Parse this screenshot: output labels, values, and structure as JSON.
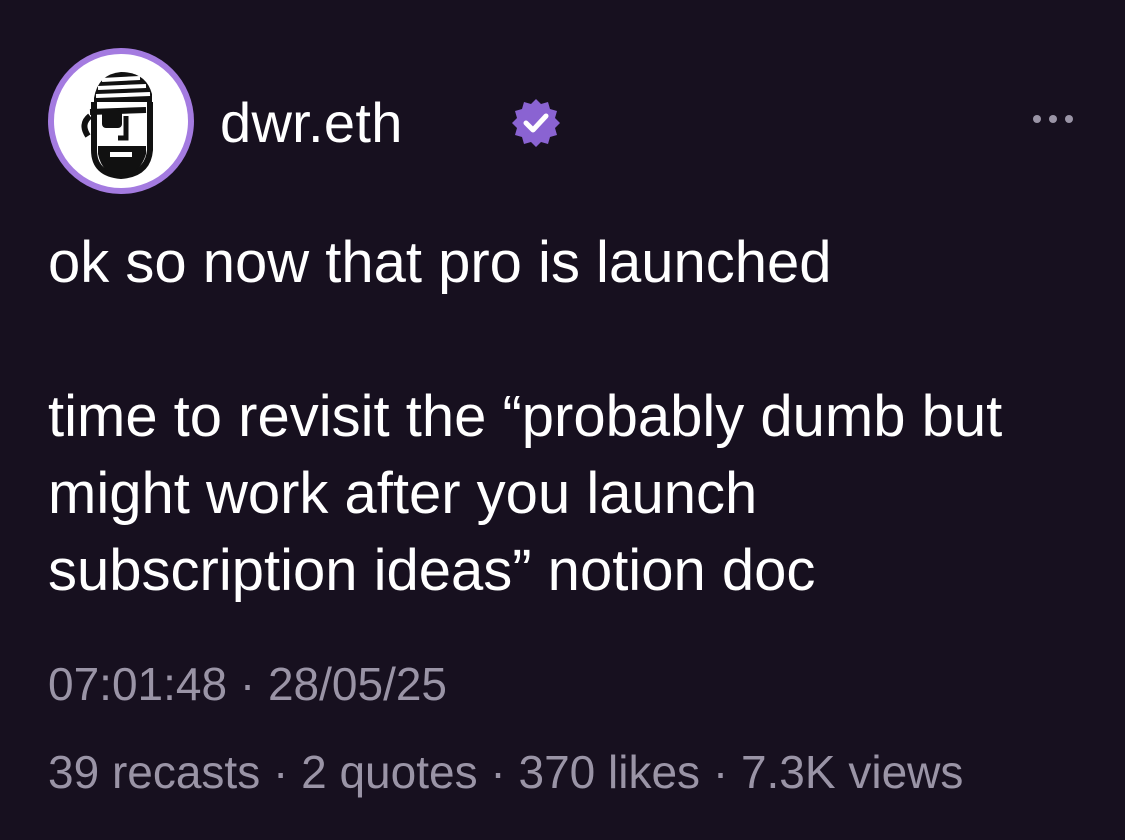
{
  "author": {
    "username": "dwr.eth",
    "verified": true,
    "avatar_icon": "pirate-face-avatar",
    "verified_icon": "verified-badge-icon",
    "more_icon": "more-horizontal-icon"
  },
  "cast": {
    "paragraph_1": "ok so now that pro is launched",
    "paragraph_2": "time to revisit the “probably dumb but\nmight work after you launch\nsubscription ideas” notion doc"
  },
  "meta": {
    "time": "07:01:48",
    "date": "28/05/25",
    "separator": " · "
  },
  "stats": {
    "recasts": "39 recasts",
    "quotes": "2 quotes",
    "likes": "370 likes",
    "views": "7.3K views",
    "separator": " · "
  },
  "colors": {
    "background": "#17101f",
    "primary_text": "#ffffff",
    "secondary_text": "#9a94a6",
    "accent_purple": "#8a63d2",
    "avatar_ring": "#a47be0"
  }
}
